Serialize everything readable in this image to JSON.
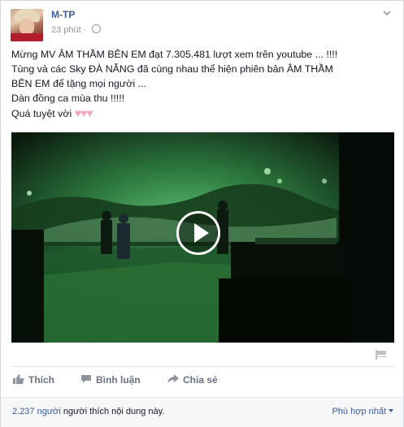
{
  "post": {
    "author": "M-TP",
    "time": "23 phút",
    "separator": "·",
    "lines": [
      "Mừng MV ÂM THẦM BÊN EM đạt 7.305.481 lượt xem trên youtube ... !!!!",
      "Tùng và các Sky ĐÀ NẴNG đã cùng nhau thể hiện phiên bản ÂM THẦM",
      "BÊN EM để tặng mọi người ...",
      "Dàn đồng ca mùa thu !!!!!",
      "Quá tuyệt vời"
    ],
    "hearts": "♥♥♥"
  },
  "video": {
    "icon": "play-icon"
  },
  "actions": {
    "like": "Thích",
    "comment": "Bình luận",
    "share": "Chia sẻ"
  },
  "likes": {
    "count": "2.237 người",
    "text": " người thích nội dung này."
  },
  "sort": {
    "label": "Phù hợp nhất"
  },
  "colors": {
    "link": "#3b5998",
    "muted": "#9197a3",
    "heart": "#f7a8bb"
  }
}
